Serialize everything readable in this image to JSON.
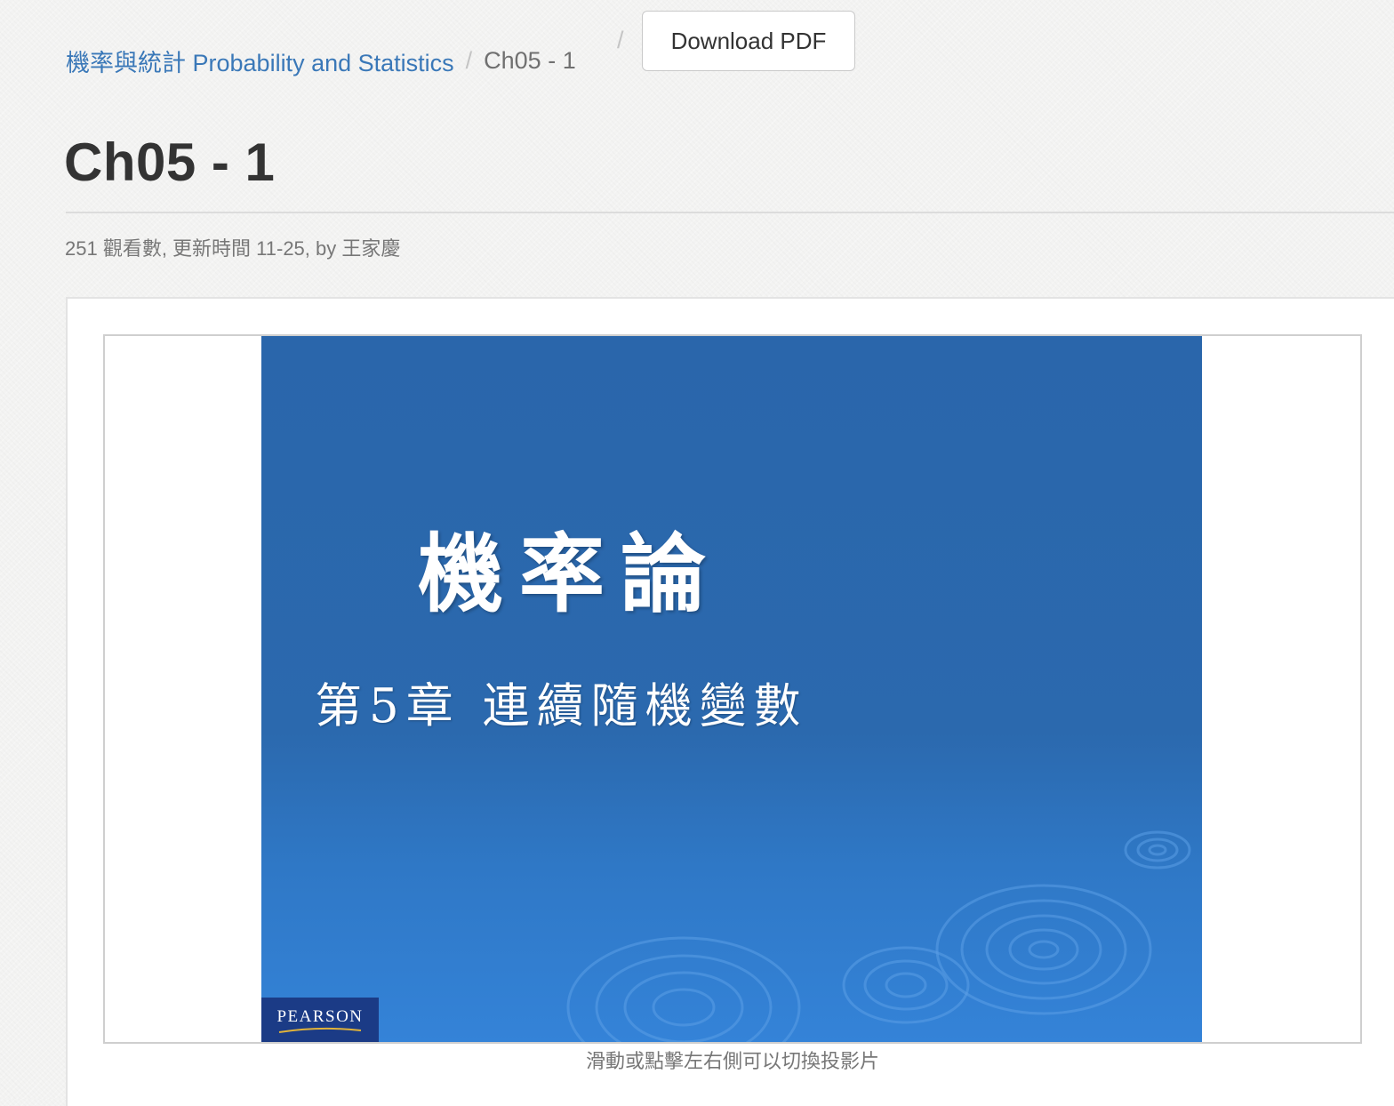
{
  "breadcrumb": {
    "course": "機率與統計 Probability and Statistics",
    "separator": "/",
    "current": "Ch05 - 1"
  },
  "toolbar": {
    "download_label": "Download PDF"
  },
  "page": {
    "title": "Ch05 - 1",
    "meta": "251 觀看數, 更新時間 11-25, by 王家慶"
  },
  "slide": {
    "title": "機率論",
    "subtitle": "第5章 連續隨機變數",
    "publisher": "PEARSON",
    "colors": {
      "background_top": "#2a66ab",
      "background_bottom": "#3483d8",
      "logo_background": "#1b3b86",
      "logo_swoosh": "#e0b23a"
    }
  },
  "viewer": {
    "hint": "滑動或點擊左右側可以切換投影片"
  },
  "colors": {
    "link": "#3a78b8",
    "title_text": "#333333",
    "meta_text": "#777777"
  }
}
